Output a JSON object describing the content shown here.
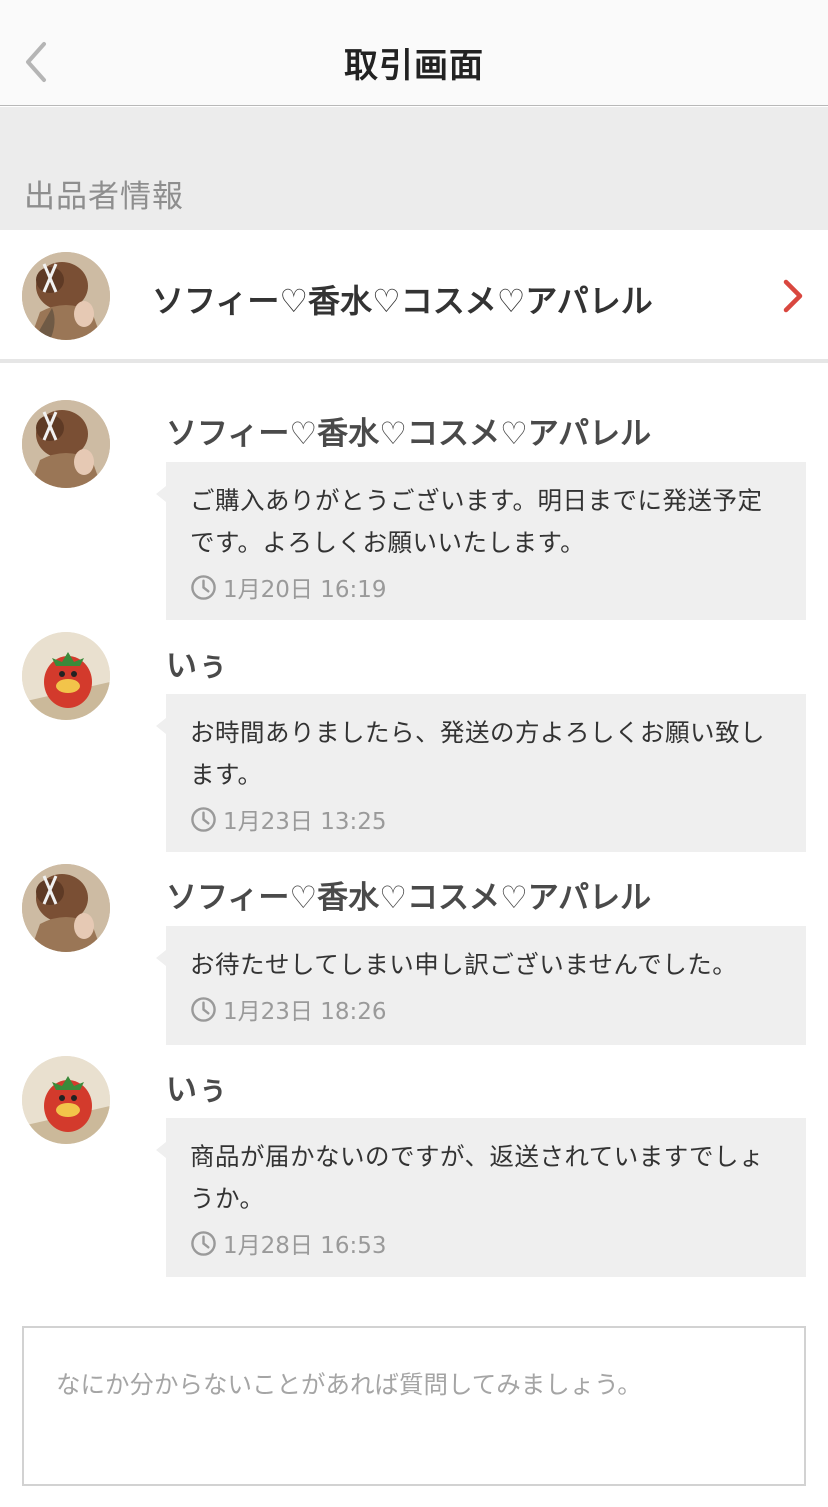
{
  "header": {
    "title": "取引画面",
    "back_icon": "chevron-left-icon"
  },
  "section": {
    "label": "出品者情報"
  },
  "seller": {
    "name": "ソフィー♡香水♡コスメ♡アパレル",
    "chevron_color": "#d9473f"
  },
  "messages": [
    {
      "sender": "ソフィー♡香水♡コスメ♡アパレル",
      "role": "seller",
      "text": "ご購入ありがとうございます。明日までに発送予定です。よろしくお願いいたします。",
      "time": "1月20日 16:19"
    },
    {
      "sender": "いぅ",
      "role": "buyer",
      "text": "お時間ありましたら、発送の方よろしくお願い致します。",
      "time": "1月23日 13:25"
    },
    {
      "sender": "ソフィー♡香水♡コスメ♡アパレル",
      "role": "seller",
      "text": "お待たせしてしまい申し訳ございませんでした。",
      "time": "1月23日 18:26"
    },
    {
      "sender": "いぅ",
      "role": "buyer",
      "text": "商品が届かないのですが、返送されていますでしょうか。",
      "time": "1月28日 16:53"
    }
  ],
  "input": {
    "placeholder": "なにか分からないことがあれば質問してみましょう。"
  }
}
